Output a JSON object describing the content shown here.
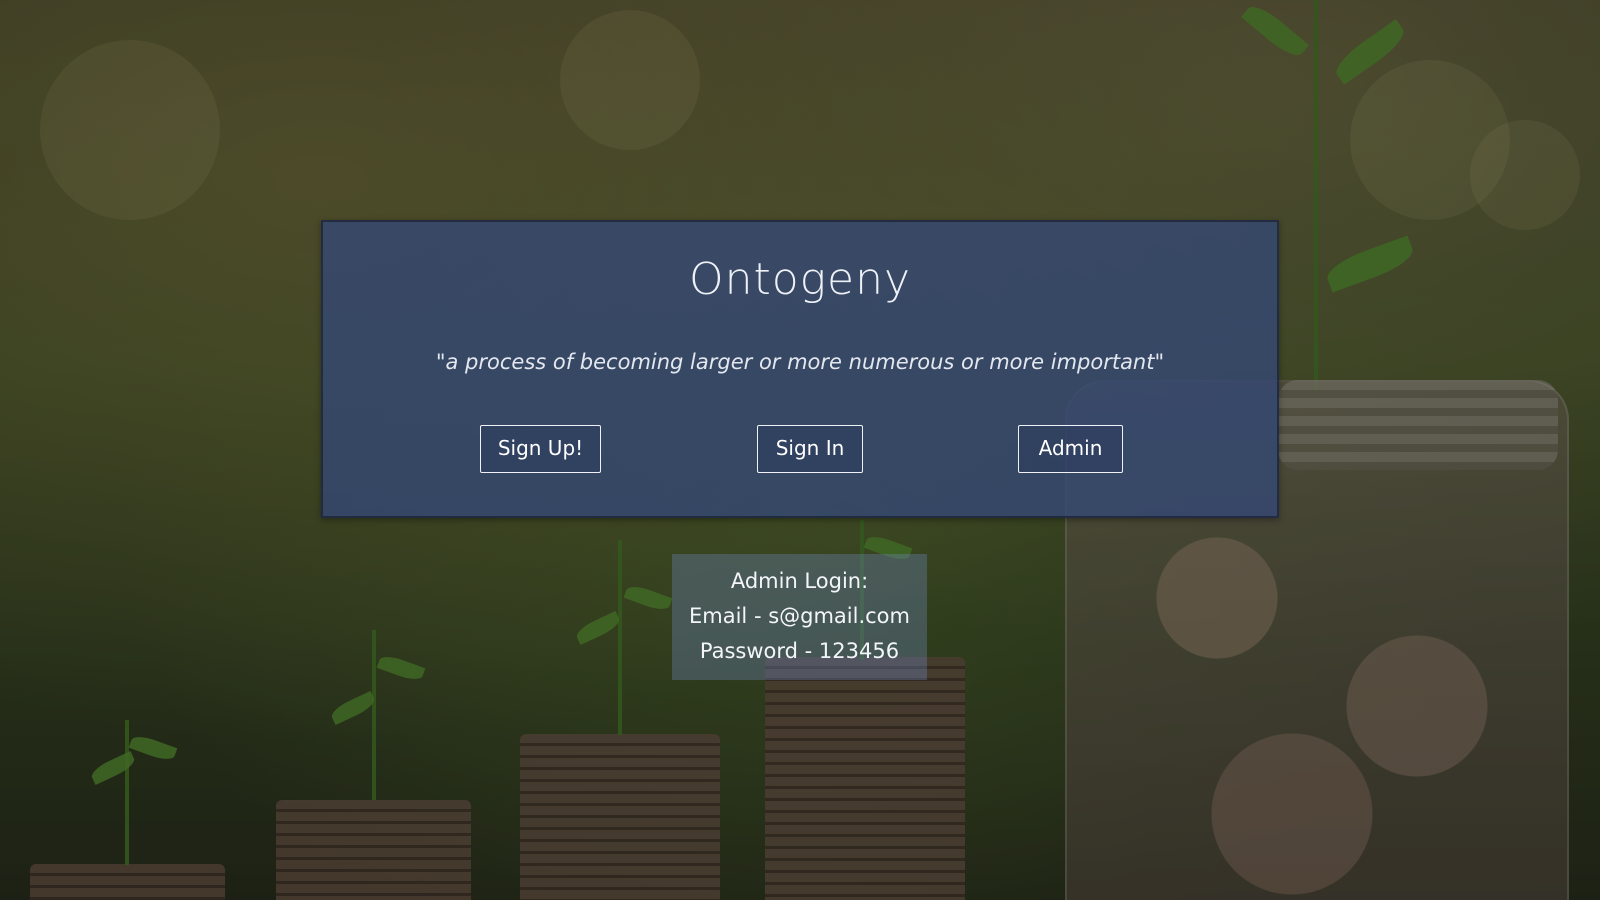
{
  "background": {
    "description_icon": "money-growth-photo"
  },
  "hero": {
    "title": "Ontogeny",
    "quote": "\"a process of becoming larger or more numerous or more important\"",
    "buttons": {
      "signup_label": "Sign Up!",
      "signin_label": "Sign In",
      "admin_label": "Admin"
    }
  },
  "admin_info": {
    "heading": "Admin Login:",
    "email_line": "Email - s@gmail.com",
    "password_line": "Password - 123456"
  },
  "colors": {
    "hero_bg": "#34487b",
    "button_border": "#f0f2f6",
    "text_light": "#eef1f6"
  }
}
